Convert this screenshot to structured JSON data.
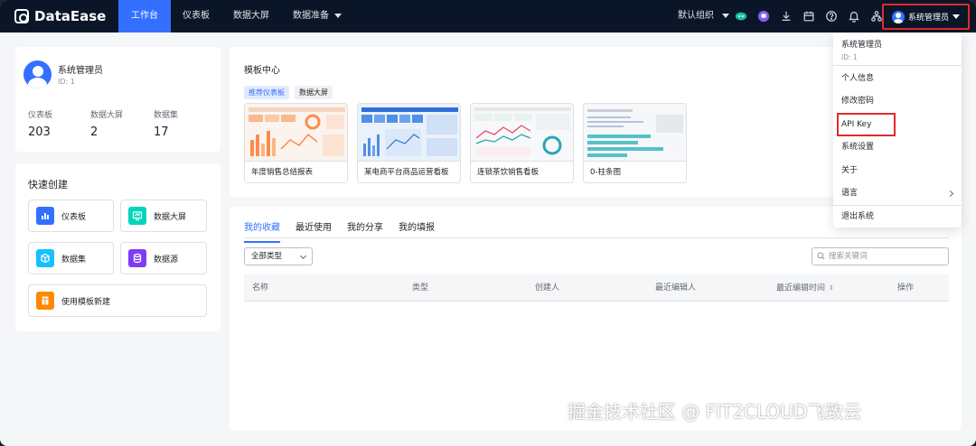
{
  "app": {
    "name": "DataEase"
  },
  "nav": {
    "items": [
      {
        "label": "工作台",
        "active": true
      },
      {
        "label": "仪表板",
        "active": false
      },
      {
        "label": "数据大屏",
        "active": false
      },
      {
        "label": "数据准备",
        "active": false,
        "has_dropdown": true
      }
    ]
  },
  "header": {
    "org_label": "默认组织",
    "user_label": "系统管理员",
    "icons": [
      "ai-assistant-icon",
      "message-icon",
      "download-icon",
      "calendar-icon",
      "help-icon",
      "bell-icon",
      "org-tree-icon"
    ]
  },
  "profile": {
    "name": "系统管理员",
    "id_text": "ID: 1",
    "stats": [
      {
        "label": "仪表板",
        "value": "203"
      },
      {
        "label": "数据大屏",
        "value": "2"
      },
      {
        "label": "数据集",
        "value": "17"
      }
    ]
  },
  "quick_create": {
    "title": "快速创建",
    "buttons": [
      {
        "label": "仪表板",
        "icon": "bar-chart-icon",
        "color": "#3370ff"
      },
      {
        "label": "数据大屏",
        "icon": "screen-icon",
        "color": "#00d6b9"
      },
      {
        "label": "数据集",
        "icon": "cube-icon",
        "color": "#16c0ff"
      },
      {
        "label": "数据源",
        "icon": "database-icon",
        "color": "#7f3bf5"
      },
      {
        "label": "使用模板新建",
        "icon": "template-icon",
        "color": "#ff8800"
      }
    ]
  },
  "templates": {
    "title": "模板中心",
    "tabs": [
      {
        "label": "推荐仪表板",
        "active": true
      },
      {
        "label": "数据大屏",
        "active": false
      }
    ],
    "cards": [
      {
        "name": "年度销售总结报表"
      },
      {
        "name": "某电商平台商品运营看板"
      },
      {
        "name": "连锁茶饮销售看板"
      },
      {
        "name": "0-柱条图"
      }
    ]
  },
  "list": {
    "tabs": [
      {
        "label": "我的收藏",
        "active": true
      },
      {
        "label": "最近使用",
        "active": false
      },
      {
        "label": "我的分享",
        "active": false
      },
      {
        "label": "我的填报",
        "active": false
      }
    ],
    "type_filter": "全部类型",
    "search_placeholder": "搜索关键词",
    "columns": [
      "名称",
      "类型",
      "创建人",
      "最近编辑人",
      "最近编辑时间",
      "操作"
    ]
  },
  "user_menu": {
    "name": "系统管理员",
    "id_text": "ID: 1",
    "items": [
      "个人信息",
      "修改密码",
      "API Key",
      "系统设置",
      "关于",
      "语言",
      "退出系统"
    ],
    "highlight_color": "#e02b2b"
  },
  "watermark": {
    "text": "掘金技术社区 @ FIT2CLOUD飞致云"
  },
  "colors": {
    "accent": "#3370ff",
    "topbar": "#0a1628"
  }
}
